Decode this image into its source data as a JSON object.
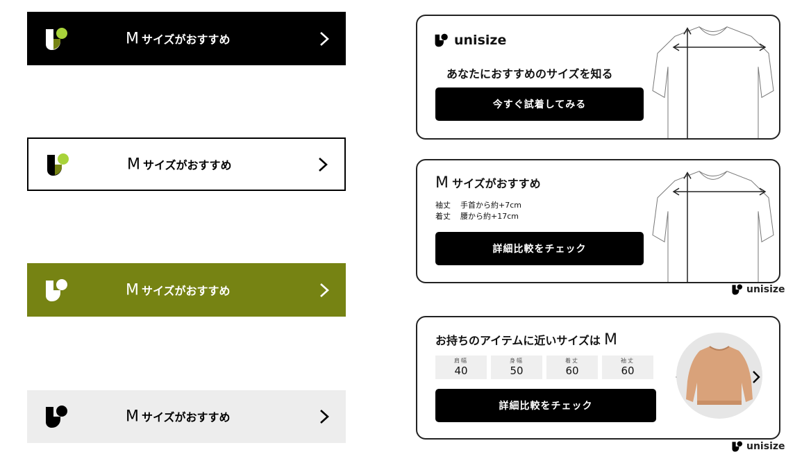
{
  "banners": [
    {
      "size": "M",
      "text": "サイズがおすすめ"
    },
    {
      "size": "M",
      "text": "サイズがおすすめ"
    },
    {
      "size": "M",
      "text": "サイズがおすすめ"
    },
    {
      "size": "M",
      "text": "サイズがおすすめ"
    }
  ],
  "card1": {
    "brand": "unisize",
    "heading": "あなたにおすすめのサイズを知る",
    "button": "今すぐ試着してみる"
  },
  "card2": {
    "size": "M",
    "heading": "サイズがおすすめ",
    "rows": [
      {
        "label": "袖丈",
        "value": "手首から約+7cm"
      },
      {
        "label": "着丈",
        "value": "腰から約+17cm"
      }
    ],
    "button": "詳細比較をチェック",
    "footer_brand": "unisize"
  },
  "card3": {
    "heading": "お持ちのアイテムに近いサイズは",
    "size": "M",
    "stats": [
      {
        "label": "肩幅",
        "value": "40"
      },
      {
        "label": "身幅",
        "value": "50"
      },
      {
        "label": "着丈",
        "value": "60"
      },
      {
        "label": "袖丈",
        "value": "60"
      }
    ],
    "button": "詳細比較をチェック",
    "footer_brand": "unisize"
  },
  "colors": {
    "olive": "#768313",
    "lime": "#a8d33a",
    "black": "#000000",
    "gray": "#ededed"
  },
  "icons": [
    "unisize-logo-icon",
    "chevron-right-icon",
    "chevron-left-icon",
    "tshirt-measure-icon",
    "sweater-image"
  ]
}
